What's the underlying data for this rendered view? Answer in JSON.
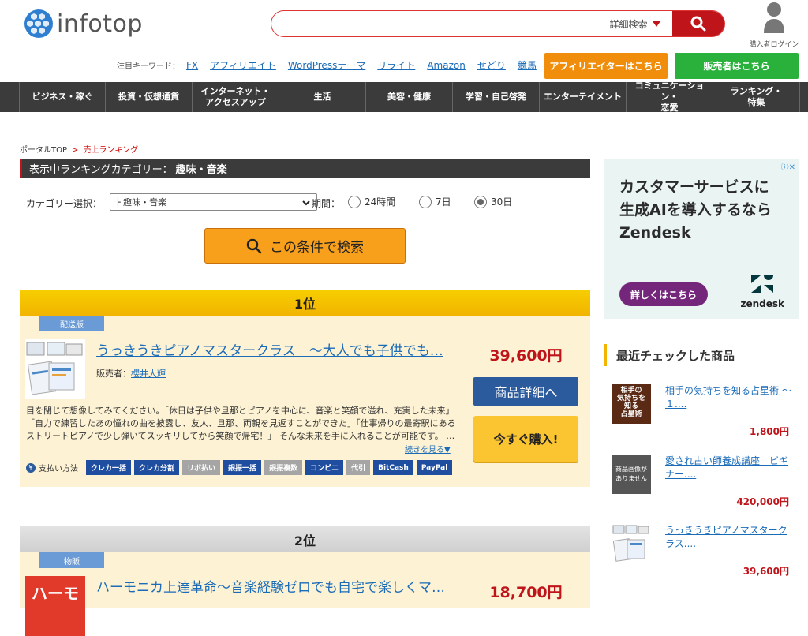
{
  "header": {
    "logo_text": "infotop",
    "search": {
      "value": "",
      "advanced_label": "詳細検索"
    },
    "buyer_login": "購入者ログイン",
    "keywords_label": "注目キーワード：",
    "keywords": [
      "FX",
      "アフィリエイト",
      "WordPressテーマ",
      "リライト",
      "Amazon",
      "せどり",
      "競馬"
    ],
    "affiliate_button": "アフィリエイターはこちら",
    "seller_button": "販売者はこちら"
  },
  "nav": [
    "ビジネス・稼ぐ",
    "投資・仮想通貨",
    "インターネット・\nアクセスアップ",
    "生活",
    "美容・健康",
    "学習・自己啓発",
    "エンターテイメント",
    "コミュニケーション・\n恋愛",
    "ランキング・\n特集"
  ],
  "breadcrumb": {
    "home": "ポータルTOP",
    "sep": ">",
    "current": "売上ランキング"
  },
  "category_bar": {
    "label": "表示中ランキングカテゴリー：",
    "value": "趣味・音楽"
  },
  "filters": {
    "category_label": "カテゴリー選択：",
    "category_value": "├ 趣味・音楽",
    "period_label": "期間：",
    "periods": [
      {
        "label": "24時間",
        "selected": false
      },
      {
        "label": "7日",
        "selected": false
      },
      {
        "label": "30日",
        "selected": true
      }
    ]
  },
  "search_button": "この条件で検索",
  "ranks": [
    {
      "rank": "1位",
      "badge": "配送版",
      "title": "うっきうきピアノマスタークラス　～大人でも子供でも…",
      "seller_label": "販売者：",
      "seller": "櫻井大輝",
      "price": "39,600円",
      "detail_button": "商品詳細へ",
      "buy_button": "今すぐ購入!",
      "description": "目を閉じて想像してみてください。「休日は子供や旦那とピアノを中心に、音楽と笑顔で溢れ、充実した未来」「自力で練習したあの憧れの曲を披露し、友人、旦那、両親を見返すことができた」「仕事帰りの最寄駅にあるストリートピアノで少し弾いてスッキリしてから笑顔で帰宅！」 そんな未来を手に入れることが可能です。 …",
      "more": "続きを見る▼",
      "payment_label": "支払い方法",
      "payments": [
        {
          "label": "クレカ一括",
          "available": true
        },
        {
          "label": "クレカ分割",
          "available": true
        },
        {
          "label": "リボ払い",
          "available": false
        },
        {
          "label": "銀振一括",
          "available": true
        },
        {
          "label": "銀振複数",
          "available": false
        },
        {
          "label": "コンビニ",
          "available": true
        },
        {
          "label": "代引",
          "available": false
        },
        {
          "label": "BitCash",
          "available": true
        },
        {
          "label": "PayPal",
          "available": true
        }
      ]
    },
    {
      "rank": "2位",
      "badge": "物販",
      "title": "ハーモニカ上達革命～音楽経験ゼロでも自宅で楽しくマ…",
      "price": "18,700円",
      "thumb_text": "ハーモ"
    }
  ],
  "ad": {
    "info": "ⓘ✕",
    "lines": [
      "カスタマーサービスに",
      "生成AIを導入するなら",
      "Zendesk"
    ],
    "button": "詳しくはこちら",
    "brand": "zendesk"
  },
  "recent": {
    "title": "最近チェックした商品",
    "items": [
      {
        "title": "相手の気持ちを知る占星術 ～１....",
        "price": "1,800円",
        "thumb_text": "相手の\n気持ちを\n知る\n占星術"
      },
      {
        "title": "愛され占い師養成講座　ビギナー....",
        "price": "420,000円",
        "thumb_text": "商品画像が\nありません"
      },
      {
        "title": "うっきうきピアノマスタークラス....",
        "price": "39,600円"
      }
    ]
  },
  "colors": {
    "brand_red": "#c0141b",
    "nav_bg": "#3b3b3b",
    "link": "#1a6bb8",
    "rank1": "#f2b400",
    "card_bg": "#fdf2d3"
  }
}
